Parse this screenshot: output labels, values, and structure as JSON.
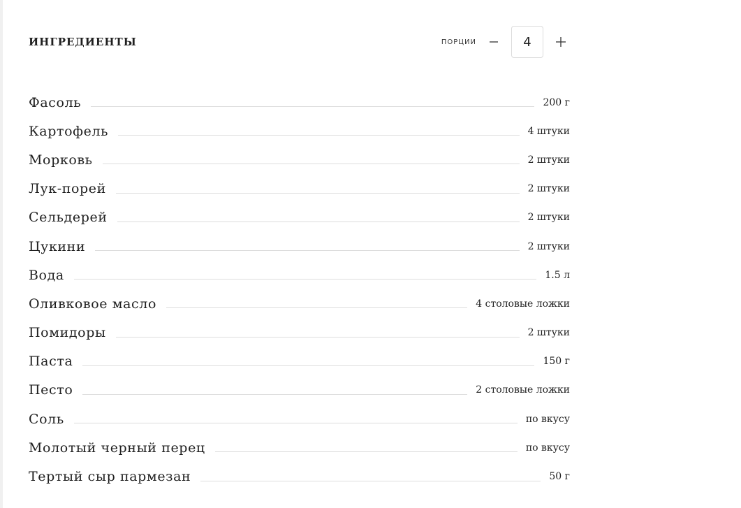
{
  "ingredients_block": {
    "title": "ИНГРЕДИЕНТЫ",
    "servings": {
      "label": "ПОРЦИИ",
      "count": "4",
      "decrement_icon": "minus-icon",
      "increment_icon": "plus-icon"
    },
    "items": [
      {
        "name": "Фасоль",
        "qty": "200 г"
      },
      {
        "name": "Картофель",
        "qty": "4 штуки"
      },
      {
        "name": "Морковь",
        "qty": "2 штуки"
      },
      {
        "name": "Лук-порей",
        "qty": "2 штуки"
      },
      {
        "name": "Сельдерей",
        "qty": "2 штуки"
      },
      {
        "name": "Цукини",
        "qty": "2 штуки"
      },
      {
        "name": "Вода",
        "qty": "1.5 л"
      },
      {
        "name": "Оливковое масло",
        "qty": "4 столовые ложки"
      },
      {
        "name": "Помидоры",
        "qty": "2 штуки"
      },
      {
        "name": "Паста",
        "qty": "150 г"
      },
      {
        "name": "Песто",
        "qty": "2 столовые ложки"
      },
      {
        "name": "Соль",
        "qty": "по вкусу"
      },
      {
        "name": "Молотый черный перец",
        "qty": "по вкусу"
      },
      {
        "name": "Тертый сыр пармезан",
        "qty": "50 г"
      }
    ]
  },
  "colors": {
    "text": "#1f1f1f",
    "leader_line": "#dddddd",
    "box_border": "#dcdcdc"
  }
}
